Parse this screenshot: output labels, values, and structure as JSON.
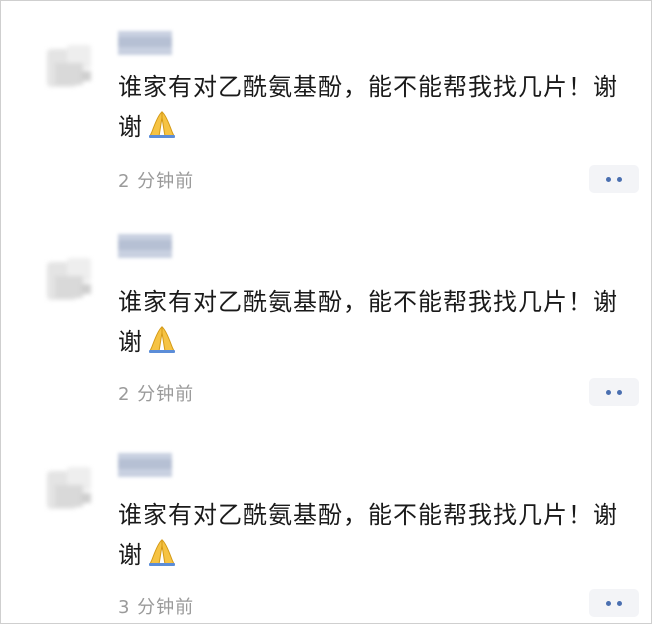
{
  "comments": [
    {
      "text": "谁家有对乙酰氨基酚，能不能帮我找几片！谢谢",
      "emoji": "folded-hands",
      "time": "2 分钟前"
    },
    {
      "text": "谁家有对乙酰氨基酚，能不能帮我找几片！谢谢",
      "emoji": "folded-hands",
      "time": "2 分钟前"
    },
    {
      "text": "谁家有对乙酰氨基酚，能不能帮我找几片！谢谢",
      "emoji": "folded-hands",
      "time": "3 分钟前"
    }
  ],
  "colors": {
    "time": "#9a9a9a",
    "more_dots": "#4a6fb0",
    "more_bg": "#f3f4f7",
    "text": "#1a1a1a"
  }
}
